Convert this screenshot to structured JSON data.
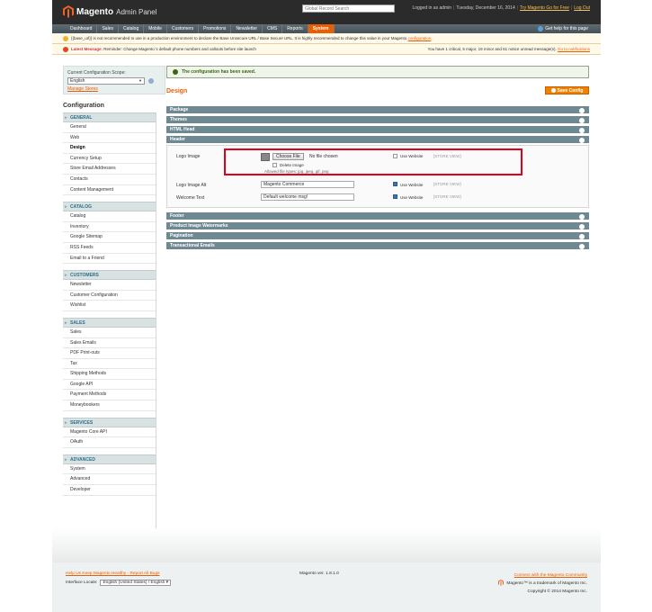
{
  "header": {
    "logo_text": "Magento",
    "logo_sub": "Admin Panel",
    "search_placeholder": "Global Record Search",
    "logged_in": "Logged in as admin",
    "date": "Tuesday, December 16, 2014",
    "try_link": "Try Magento Go for Free",
    "logout": "Log Out",
    "help": "Get help for this page"
  },
  "nav": {
    "items": [
      "Dashboard",
      "Sales",
      "Catalog",
      "Mobile",
      "Customers",
      "Promotions",
      "Newsletter",
      "CMS",
      "Reports",
      "System"
    ],
    "active_index": 9
  },
  "notices": {
    "url_text": "{{base_url}} is not recommended to use in a production environment to declare the Base Unsecure URL / Base Secure URL. It is highly recommended to change this value in your Magento",
    "url_link": "configuration",
    "latest_label": "Latest Message:",
    "latest_text": "Reminder: Change Magento`s default phone numbers and callouts before site launch",
    "summary_text": "You have 1 critical, 5 major, 19 minor and 61 notice unread message(s).",
    "summary_link": "Go to notifications"
  },
  "scope": {
    "label": "Current Configuration Scope:",
    "value": "English",
    "manage_stores": "Manage Stores"
  },
  "sidebar": {
    "title": "Configuration",
    "sections": [
      {
        "title": "GENERAL",
        "items": [
          "General",
          "Web",
          "Design",
          "Currency Setup",
          "Store Email Addresses",
          "Contacts",
          "Content Management"
        ]
      },
      {
        "title": "CATALOG",
        "items": [
          "Catalog",
          "Inventory",
          "Google Sitemap",
          "RSS Feeds",
          "Email to a Friend"
        ]
      },
      {
        "title": "CUSTOMERS",
        "items": [
          "Newsletter",
          "Customer Configuration",
          "Wishlist"
        ]
      },
      {
        "title": "SALES",
        "items": [
          "Sales",
          "Sales Emails",
          "PDF Print-outs",
          "Tax",
          "Shipping Methods",
          "Google API",
          "Payment Methods",
          "Moneybookers"
        ]
      },
      {
        "title": "SERVICES",
        "items": [
          "Magento Core API",
          "OAuth"
        ]
      },
      {
        "title": "ADVANCED",
        "items": [
          "System",
          "Advanced",
          "Developer"
        ]
      }
    ],
    "active_item": "Design"
  },
  "main": {
    "success": "The configuration has been saved.",
    "title": "Design",
    "save_button": "Save Config",
    "groups_top": [
      "Package",
      "Themes",
      "HTML Head",
      "Header"
    ],
    "groups_bottom": [
      "Footer",
      "Product Image Watermarks",
      "Pagination",
      "Transactional Emails"
    ],
    "header_fields": {
      "logo_label": "Logo Image",
      "choose_file": "Choose File",
      "no_file": "No file chosen",
      "delete_image": "Delete Image",
      "allowed_types": "Allowed file types: jpg, jpeg, gif, png",
      "logo_alt_label": "Logo Image Alt",
      "logo_alt_value": "Magento Commerce",
      "welcome_label": "Welcome Text",
      "welcome_value": "Default welcome msg!",
      "use_website": "Use Website",
      "store_view": "[STORE VIEW]"
    }
  },
  "footer": {
    "help_link": "Help Us Keep Magento Healthy - Report All Bugs",
    "locale_label": "Interface Locale:",
    "locale_value": "English (United States) / English",
    "version": "Magento ver. 1.8.1.0",
    "community_link": "Connect with the Magento Community",
    "trademark": "Magento™ is a trademark of Magento Inc.",
    "copyright": "Copyright © 2014 Magento Inc."
  },
  "colors": {
    "accent": "#eb5e00",
    "nav_bg": "#46525a",
    "group_header": "#6f8992",
    "highlight": "#e0001b"
  }
}
